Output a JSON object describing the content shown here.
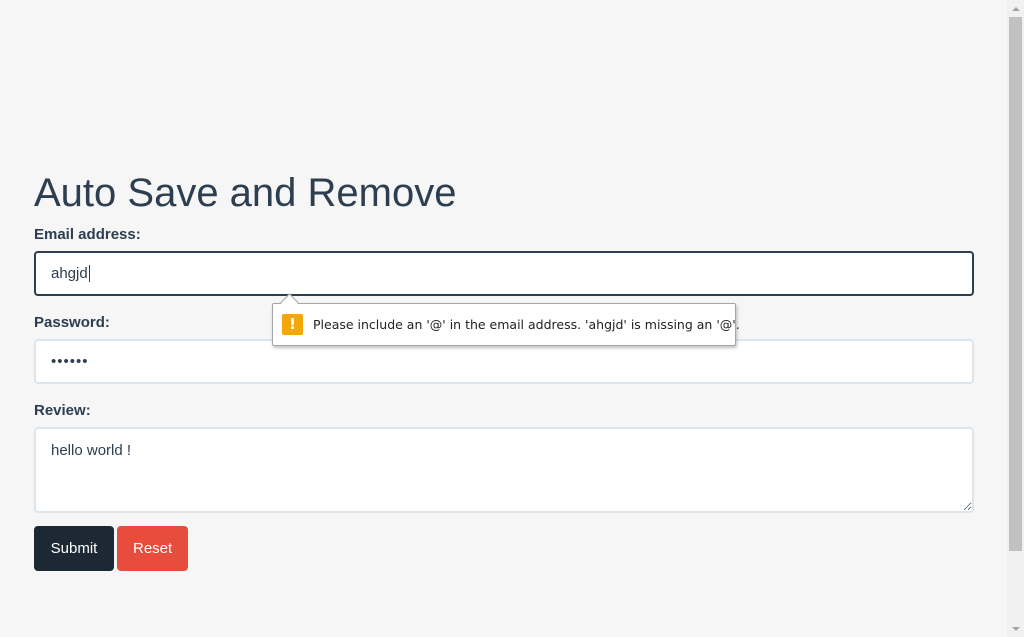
{
  "page": {
    "title": "Auto Save and Remove"
  },
  "form": {
    "email_label": "Email address:",
    "email_value": "ahgjd",
    "password_label": "Password:",
    "password_mask": "••••••",
    "review_label": "Review:",
    "review_value": "hello world !",
    "submit_label": "Submit",
    "reset_label": "Reset"
  },
  "validation": {
    "icon_glyph": "!",
    "icon": "warning-icon",
    "message": "Please include an '@' in the email address. 'ahgjd' is missing an '@'."
  },
  "colors": {
    "text": "#2c3e50",
    "submit_bg": "#1c2833",
    "reset_bg": "#e74c3c",
    "warning": "#f5a70a"
  }
}
